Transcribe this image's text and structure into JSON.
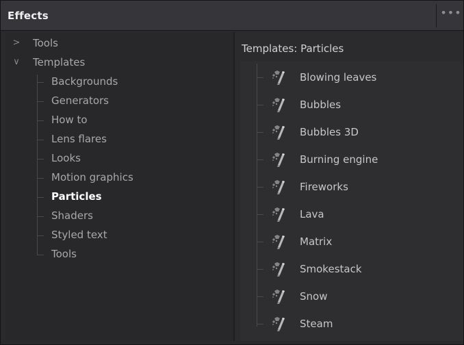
{
  "header": {
    "title": "Effects",
    "more_label": "•••"
  },
  "tree": {
    "top": [
      {
        "label": "Tools",
        "expanded": false,
        "chevron": ">"
      },
      {
        "label": "Templates",
        "expanded": true,
        "chevron": "∨"
      }
    ],
    "template_children": [
      {
        "label": "Backgrounds"
      },
      {
        "label": "Generators"
      },
      {
        "label": "How to"
      },
      {
        "label": "Lens flares"
      },
      {
        "label": "Looks"
      },
      {
        "label": "Motion graphics"
      },
      {
        "label": "Particles",
        "selected": true
      },
      {
        "label": "Shaders"
      },
      {
        "label": "Styled text"
      },
      {
        "label": "Tools"
      }
    ]
  },
  "content": {
    "header": "Templates: Particles",
    "items": [
      {
        "label": "Blowing leaves",
        "icon": "fx-wand-icon"
      },
      {
        "label": "Bubbles",
        "icon": "fx-wand-icon"
      },
      {
        "label": "Bubbles 3D",
        "icon": "fx-wand-icon"
      },
      {
        "label": "Burning engine",
        "icon": "fx-wand-icon"
      },
      {
        "label": "Fireworks",
        "icon": "fx-wand-icon"
      },
      {
        "label": "Lava",
        "icon": "fx-wand-icon"
      },
      {
        "label": "Matrix",
        "icon": "fx-wand-icon"
      },
      {
        "label": "Smokestack",
        "icon": "fx-wand-icon"
      },
      {
        "label": "Snow",
        "icon": "fx-wand-icon"
      },
      {
        "label": "Steam",
        "icon": "fx-wand-icon"
      }
    ]
  },
  "colors": {
    "panel_bg": "#2a2a2d",
    "titlebar_bg": "#36363a",
    "text": "#c7c7cb",
    "selected_text": "#ffffff"
  }
}
